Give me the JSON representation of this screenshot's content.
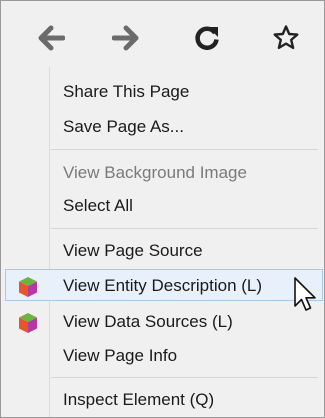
{
  "nav": {
    "back_icon": "arrow-left-icon",
    "forward_icon": "arrow-right-icon",
    "reload_icon": "reload-icon",
    "bookmark_icon": "star-outline-icon"
  },
  "menu": {
    "items": [
      {
        "label": "Share This Page",
        "enabled": true
      },
      {
        "label": "Save Page As...",
        "enabled": true
      },
      {
        "label": "View Background Image",
        "enabled": false
      },
      {
        "label": "Select All",
        "enabled": true
      },
      {
        "label": "View Page Source",
        "enabled": true
      },
      {
        "label": "View Entity Description (L)",
        "enabled": true,
        "highlighted": true,
        "icon": "cube-icon"
      },
      {
        "label": "View Data Sources (L)",
        "enabled": true,
        "icon": "cube-icon"
      },
      {
        "label": "View Page Info",
        "enabled": true
      },
      {
        "label": "Inspect Element (Q)",
        "enabled": true
      }
    ]
  },
  "colors": {
    "menu_bg": "#f0f0f0",
    "highlight_bg": "#e8f1fb",
    "highlight_border": "#a8c8e8",
    "disabled_text": "#7a7a7a",
    "cube_top": "#6cb33f",
    "cube_left": "#e8552a",
    "cube_right": "#b23aa6"
  },
  "cursor": {
    "icon": "mouse-pointer-icon"
  }
}
